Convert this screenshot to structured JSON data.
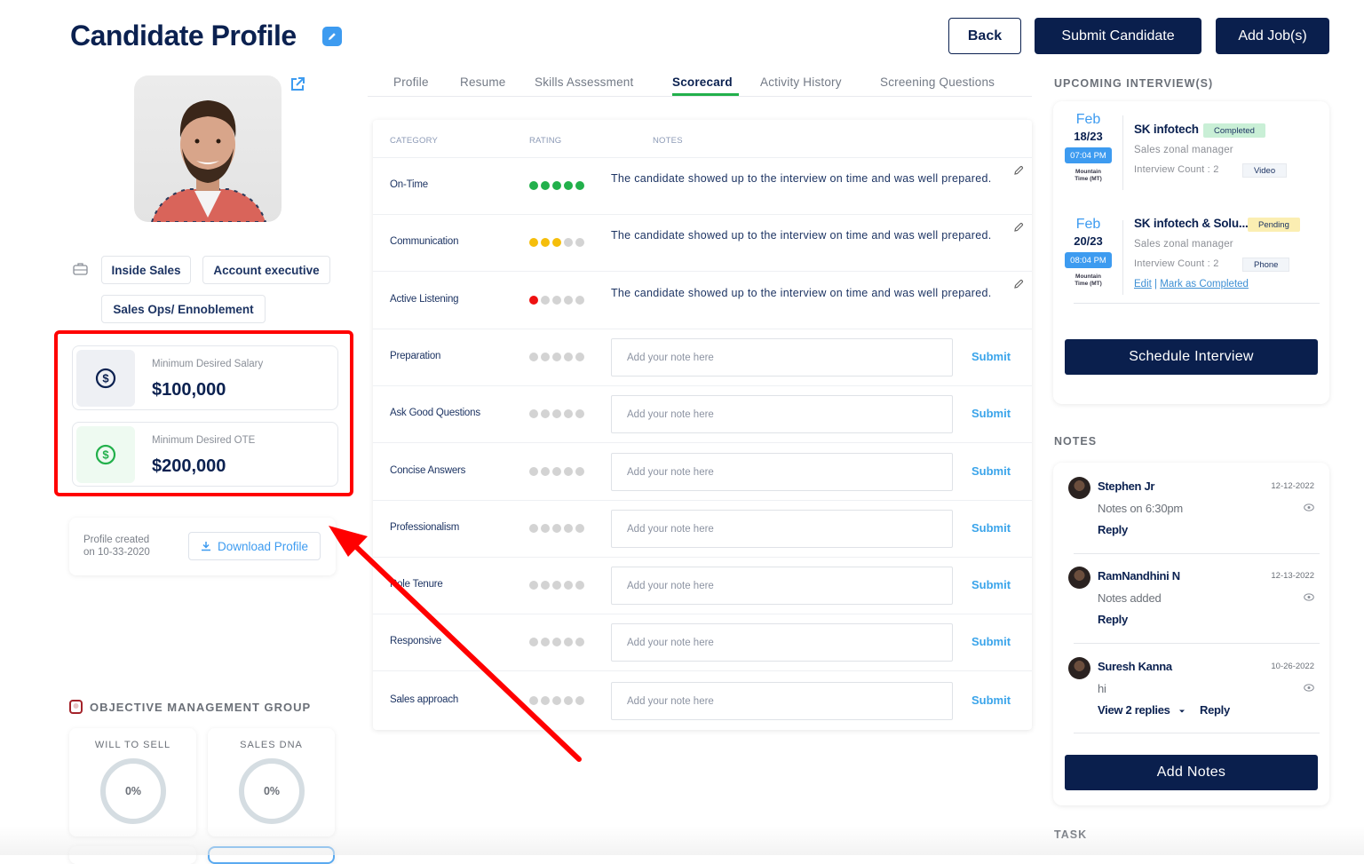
{
  "header": {
    "title": "Candidate Profile",
    "back_label": "Back",
    "submit_candidate_label": "Submit Candidate",
    "add_jobs_label": "Add Job(s)"
  },
  "profile": {
    "tags": [
      "Inside Sales",
      "Account executive",
      "Sales Ops/ Ennoblement"
    ],
    "salary": {
      "label": "Minimum Desired Salary",
      "value": "$100,000"
    },
    "ote": {
      "label": "Minimum Desired OTE",
      "value": "$200,000"
    },
    "created_line1": "Profile created",
    "created_line2": "on 10-33-2020",
    "download_label": "Download Profile"
  },
  "omg": {
    "title": "OBJECTIVE MANAGEMENT GROUP",
    "cards": [
      {
        "label": "WILL TO SELL",
        "value": "0%"
      },
      {
        "label": "SALES DNA",
        "value": "0%"
      }
    ]
  },
  "tabs": [
    {
      "label": "Profile",
      "active": false
    },
    {
      "label": "Resume",
      "active": false
    },
    {
      "label": "Skills Assessment",
      "active": false
    },
    {
      "label": "Scorecard",
      "active": true
    },
    {
      "label": "Activity History",
      "active": false
    },
    {
      "label": "Screening Questions",
      "active": false
    }
  ],
  "scorecard": {
    "headers": {
      "category": "CATEGORY",
      "rating": "RATING",
      "notes": "NOTES"
    },
    "rating_max": 5,
    "rating_colors": {
      "high": "#22b04b",
      "mid": "#f5be0b",
      "low": "#ee1111",
      "empty": "#d3d3d3"
    },
    "note_placeholder": "Add your note here",
    "submit_label": "Submit",
    "rows": [
      {
        "category": "On-Time",
        "rating": 5,
        "color": "high",
        "note": "The candidate showed up to the interview on time and was well prepared."
      },
      {
        "category": "Communication",
        "rating": 3,
        "color": "mid",
        "note": "The candidate showed up to the interview on time and was well prepared."
      },
      {
        "category": "Active Listening",
        "rating": 1,
        "color": "low",
        "note": "The candidate showed up to the interview on time and was well prepared."
      },
      {
        "category": "Preparation",
        "rating": 0,
        "color": "empty",
        "note": null
      },
      {
        "category": "Ask Good Questions",
        "rating": 0,
        "color": "empty",
        "note": null
      },
      {
        "category": "Concise Answers",
        "rating": 0,
        "color": "empty",
        "note": null
      },
      {
        "category": "Professionalism",
        "rating": 0,
        "color": "empty",
        "note": null
      },
      {
        "category": "Role Tenure",
        "rating": 0,
        "color": "empty",
        "note": null
      },
      {
        "category": "Responsive",
        "rating": 0,
        "color": "empty",
        "note": null
      },
      {
        "category": "Sales approach",
        "rating": 0,
        "color": "empty",
        "note": null
      }
    ]
  },
  "interviews": {
    "heading": "UPCOMING INTERVIEW(S)",
    "items": [
      {
        "month": "Feb",
        "day": "18/23",
        "time": "07:04 PM",
        "tz_line1": "Mountain",
        "tz_line2": "Time (MT)",
        "company": "SK infotech",
        "status": "Completed",
        "status_color": "#c9efd6",
        "role": "Sales zonal manager",
        "count": "Interview Count : 2",
        "mode": "Video"
      },
      {
        "month": "Feb",
        "day": "20/23",
        "time": "08:04 PM",
        "tz_line1": "Mountain",
        "tz_line2": "Time (MT)",
        "company": "SK infotech & Solu...",
        "status": "Pending",
        "status_color": "#fbeeb2",
        "role": "Sales zonal manager",
        "count": "Interview Count : 2",
        "mode": "Phone",
        "edit_label": "Edit",
        "separator": "|",
        "mark_completed_label": "Mark as Completed"
      }
    ],
    "schedule_label": "Schedule Interview"
  },
  "notes": {
    "heading": "NOTES",
    "items": [
      {
        "author": "Stephen Jr",
        "date": "12-12-2022",
        "body": "Notes on 6:30pm",
        "reply_label": "Reply"
      },
      {
        "author": "RamNandhini N",
        "date": "12-13-2022",
        "body": "Notes added",
        "reply_label": "Reply"
      },
      {
        "author": "Suresh Kanna",
        "date": "10-26-2022",
        "body": "hi",
        "view_replies_label": "View 2 replies",
        "reply_label": "Reply"
      }
    ],
    "add_notes_label": "Add Notes"
  },
  "task": {
    "heading": "TASK"
  },
  "annotation": {
    "highlight_color": "#ff0000"
  }
}
